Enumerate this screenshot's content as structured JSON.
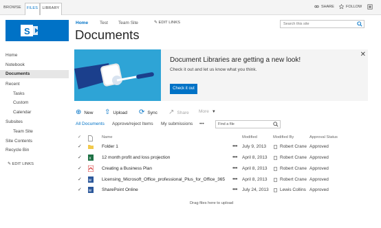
{
  "ribbon": {
    "tabs": [
      "BROWSE",
      "FILES",
      "LIBRARY"
    ],
    "share": "SHARE",
    "follow": "FOLLOW"
  },
  "topnav": {
    "items": [
      "Home",
      "Test",
      "Team Site"
    ],
    "edit_links": "EDIT LINKS"
  },
  "page_title": "Documents",
  "search": {
    "placeholder": "Search this site"
  },
  "leftnav": {
    "items": [
      {
        "label": "Home"
      },
      {
        "label": "Notebook"
      },
      {
        "label": "Documents"
      },
      {
        "label": "Recent"
      },
      {
        "label": "Tasks"
      },
      {
        "label": "Custom"
      },
      {
        "label": "Calendar"
      },
      {
        "label": "Subsites"
      },
      {
        "label": "Team Site"
      },
      {
        "label": "Site Contents"
      },
      {
        "label": "Recycle Bin"
      }
    ],
    "edit_links": "EDIT LINKS"
  },
  "banner": {
    "title": "Document Libraries are getting a new look!",
    "subtitle": "Check it out and let us know what you think.",
    "button": "Check it out",
    "close": "✕"
  },
  "commands": {
    "new": "New",
    "upload": "Upload",
    "sync": "Sync",
    "share": "Share",
    "more": "More"
  },
  "views": {
    "all": "All Documents",
    "approve": "Approve/reject Items",
    "mine": "My submissions",
    "more": "•••",
    "find_placeholder": "Find a file"
  },
  "columns": {
    "name": "Name",
    "modified": "Modified",
    "modified_by": "Modified By",
    "status": "Approval Status"
  },
  "rows": [
    {
      "name": "Folder 1",
      "type": "folder",
      "modified": "July 9, 2013",
      "modified_by": "Robert Crane",
      "status": "Approved"
    },
    {
      "name": "12 month profit and loss projection",
      "type": "excel",
      "modified": "April 8, 2013",
      "modified_by": "Robert Crane",
      "status": "Approved"
    },
    {
      "name": "Creating a Business Plan",
      "type": "pdf",
      "modified": "April 8, 2013",
      "modified_by": "Robert Crane",
      "status": "Approved"
    },
    {
      "name": "Licensing_Microsoft_Office_professional_Plus_for_Office_365",
      "type": "word",
      "modified": "April 8, 2013",
      "modified_by": "Robert Crane",
      "status": "Approved"
    },
    {
      "name": "SharePoint Online",
      "type": "word",
      "modified": "July 24, 2013",
      "modified_by": "Lewis Collins",
      "status": "Approved"
    }
  ],
  "drag_hint": "Drag files here to upload",
  "colors": {
    "accent": "#0072c6",
    "banner_art": "#2ea4d6"
  }
}
